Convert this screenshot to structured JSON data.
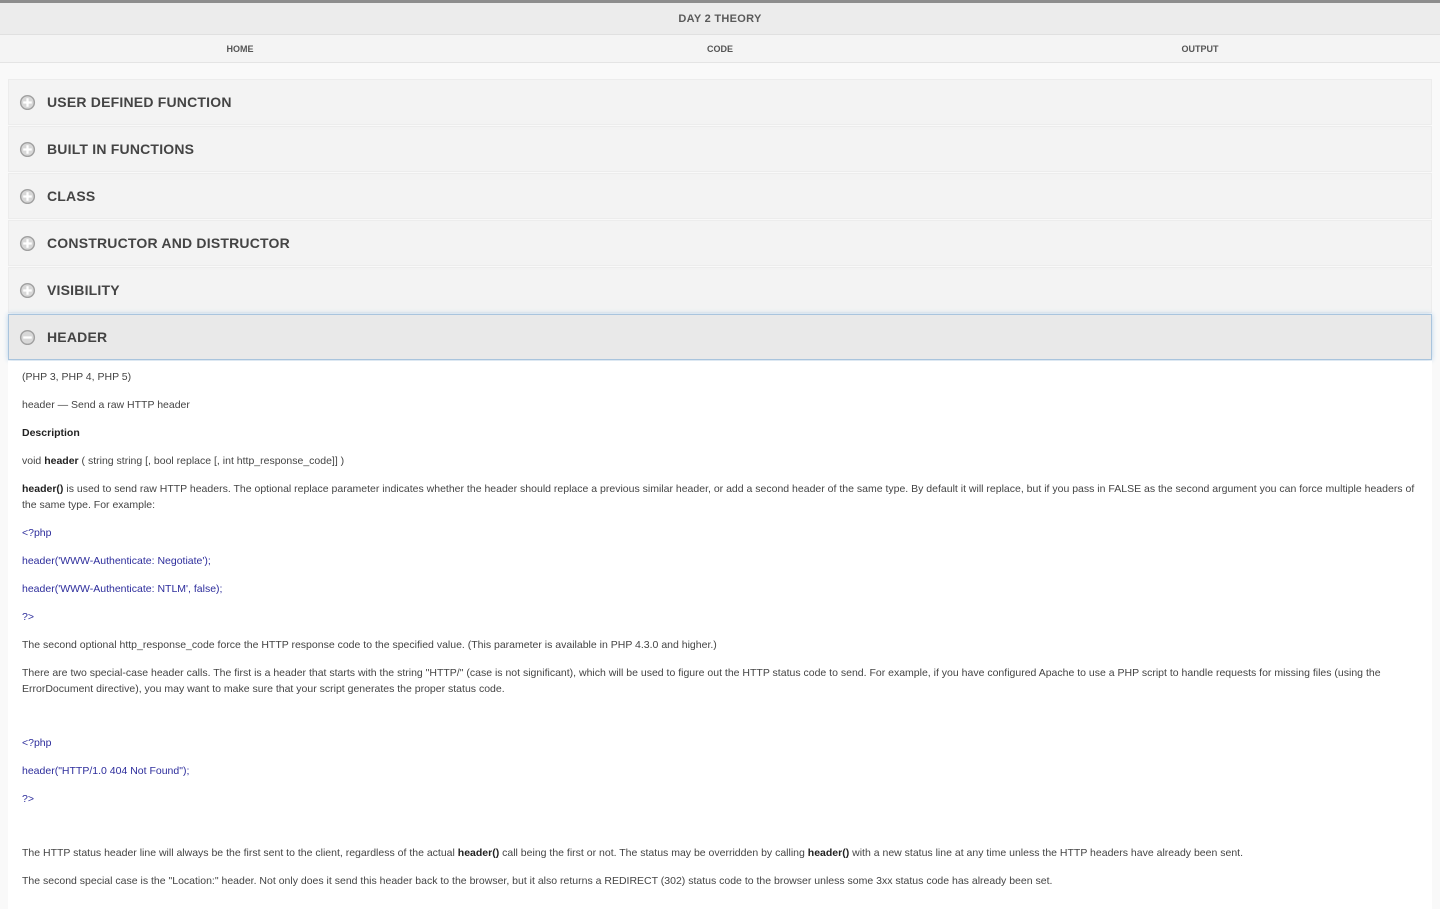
{
  "header": {
    "title": "DAY 2 THEORY"
  },
  "nav": [
    {
      "label": "HOME"
    },
    {
      "label": "CODE"
    },
    {
      "label": "OUTPUT"
    }
  ],
  "accordion": [
    {
      "label": "USER DEFINED FUNCTION",
      "icon": "plus-circle-icon"
    },
    {
      "label": "BUILT IN FUNCTIONS",
      "icon": "plus-circle-icon"
    },
    {
      "label": "CLASS",
      "icon": "plus-circle-icon"
    },
    {
      "label": "CONSTRUCTOR AND DISTRUCTOR",
      "icon": "plus-circle-icon"
    },
    {
      "label": "VISIBILITY",
      "icon": "plus-circle-icon"
    },
    {
      "label": "HEADER",
      "icon": "minus-circle-icon"
    }
  ],
  "content": {
    "versions": "(PHP 3, PHP 4, PHP 5)",
    "summary": "header — Send a raw HTTP header",
    "description_heading": "Description",
    "signature_pre": "void ",
    "signature_fn": "header",
    "signature_post": " ( string string [, bool replace [, int http_response_code]] )",
    "para1_fn": "header()",
    "para1": " is used to send raw HTTP headers. The optional replace parameter indicates whether the header should replace a previous similar header, or add a second header of the same type. By default it will replace, but if you pass in FALSE as the second argument you can force multiple headers of the same type. For example:",
    "code1": [
      "<?php",
      "header('WWW-Authenticate: Negotiate');",
      "header('WWW-Authenticate: NTLM', false);",
      "?>"
    ],
    "para2": "The second optional http_response_code force the HTTP response code to the specified value. (This parameter is available in PHP 4.3.0 and higher.)",
    "para3": "There are two special-case header calls. The first is a header that starts with the string \"HTTP/\" (case is not significant), which will be used to figure out the HTTP status code to send. For example, if you have configured Apache to use a PHP script to handle requests for missing files (using the ErrorDocument directive), you may want to make sure that your script generates the proper status code.",
    "code2": [
      "<?php",
      "header(\"HTTP/1.0 404 Not Found\");",
      "?>"
    ],
    "para4_pre": "The HTTP status header line will always be the first sent to the client, regardless of the actual ",
    "para4_fn": "header()",
    "para4_mid": " call being the first or not. The status may be overridden by calling ",
    "para4_fn2": "header()",
    "para4_post": " with a new status line at any time unless the HTTP headers have already been sent.",
    "para5": "The second special case is the \"Location:\" header. Not only does it send this header back to the browser, but it also returns a REDIRECT (302) status code to the browser unless some 3xx status code has already been set."
  }
}
